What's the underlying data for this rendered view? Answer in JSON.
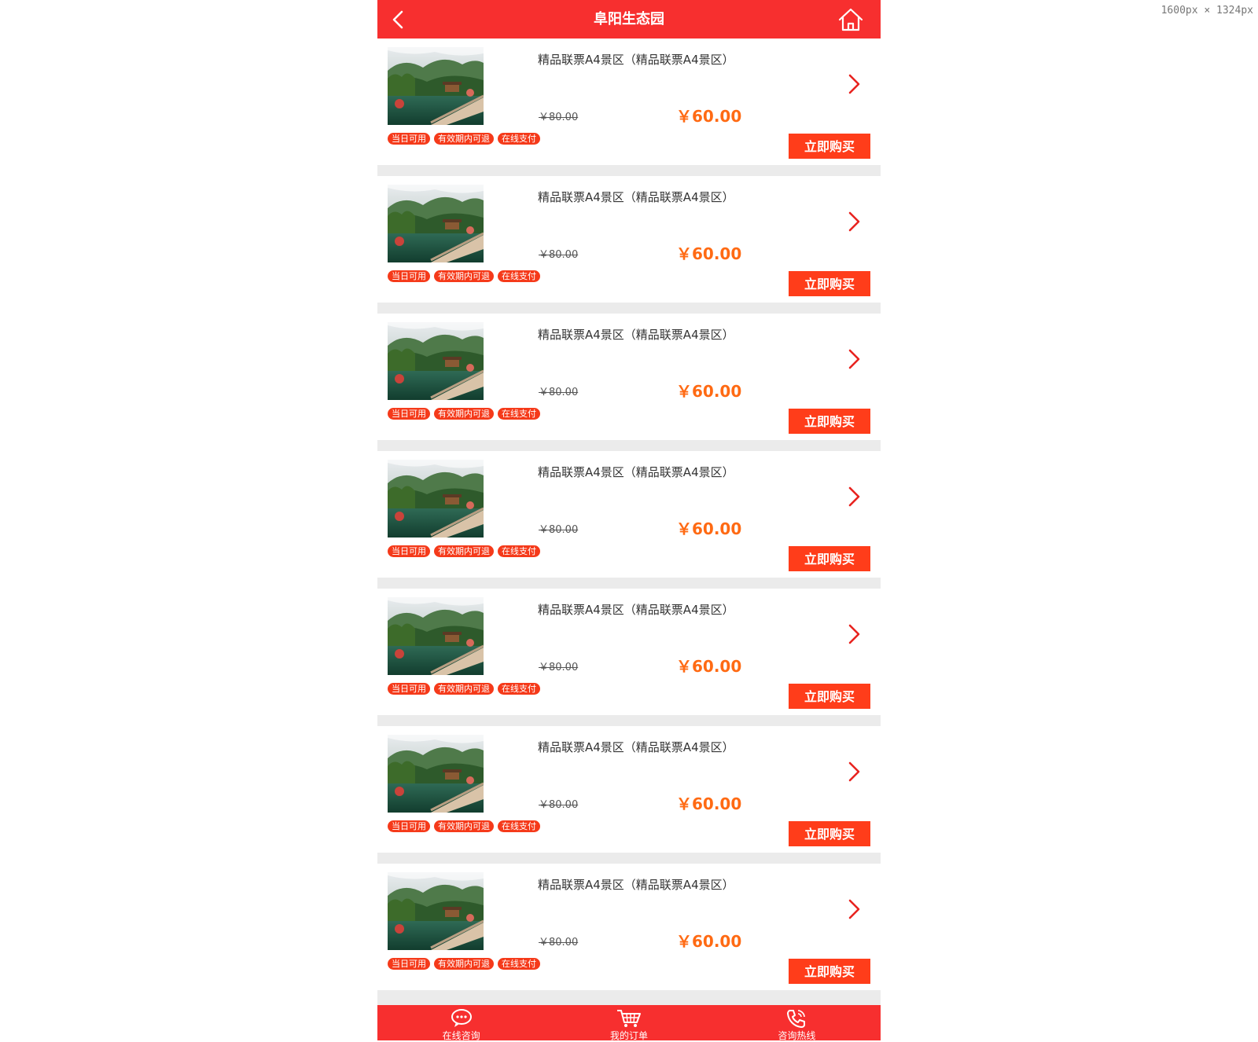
{
  "screen_label": "1600px × 1324px",
  "header": {
    "title": "阜阳生态园",
    "back_icon": "chevron-left-icon",
    "home_icon": "home-icon"
  },
  "colors": {
    "brand_red": "#f72f2f",
    "price_orange": "#ff6a13",
    "button_red": "#ff3d1a",
    "divider_gray": "#ebebeb"
  },
  "tickets": [
    {
      "title": "精品联票A4景区（精品联票A4景区）",
      "old_price": "￥80.00",
      "price": "￥60.00",
      "tags": [
        "当日可用",
        "有效期内可退",
        "在线支付"
      ],
      "buy_label": "立即购买"
    },
    {
      "title": "精品联票A4景区（精品联票A4景区）",
      "old_price": "￥80.00",
      "price": "￥60.00",
      "tags": [
        "当日可用",
        "有效期内可退",
        "在线支付"
      ],
      "buy_label": "立即购买"
    },
    {
      "title": "精品联票A4景区（精品联票A4景区）",
      "old_price": "￥80.00",
      "price": "￥60.00",
      "tags": [
        "当日可用",
        "有效期内可退",
        "在线支付"
      ],
      "buy_label": "立即购买"
    },
    {
      "title": "精品联票A4景区（精品联票A4景区）",
      "old_price": "￥80.00",
      "price": "￥60.00",
      "tags": [
        "当日可用",
        "有效期内可退",
        "在线支付"
      ],
      "buy_label": "立即购买"
    },
    {
      "title": "精品联票A4景区（精品联票A4景区）",
      "old_price": "￥80.00",
      "price": "￥60.00",
      "tags": [
        "当日可用",
        "有效期内可退",
        "在线支付"
      ],
      "buy_label": "立即购买"
    },
    {
      "title": "精品联票A4景区（精品联票A4景区）",
      "old_price": "￥80.00",
      "price": "￥60.00",
      "tags": [
        "当日可用",
        "有效期内可退",
        "在线支付"
      ],
      "buy_label": "立即购买"
    },
    {
      "title": "精品联票A4景区（精品联票A4景区）",
      "old_price": "￥80.00",
      "price": "￥60.00",
      "tags": [
        "当日可用",
        "有效期内可退",
        "在线支付"
      ],
      "buy_label": "立即购买"
    }
  ],
  "footer": {
    "tabs": [
      {
        "label": "在线咨询",
        "icon": "chat-bubble-icon"
      },
      {
        "label": "我的订单",
        "icon": "shopping-cart-icon"
      },
      {
        "label": "咨询热线",
        "icon": "phone-icon"
      }
    ]
  }
}
